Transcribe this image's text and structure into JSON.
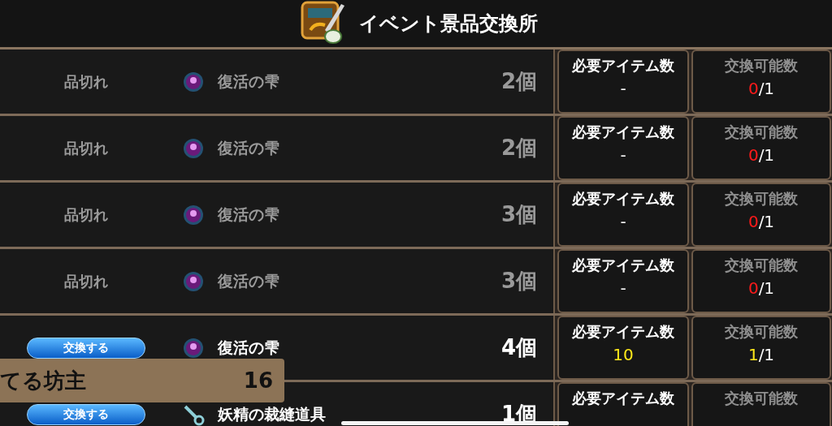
{
  "header": {
    "title": "イベント景品交換所"
  },
  "rows": [
    {
      "kind": "sold_out",
      "status": "品切れ",
      "item": {
        "kind": "orb",
        "name": "復活の雫"
      },
      "count": "2個",
      "required_label": "必要アイテム数",
      "required_value": "-",
      "exchange_label": "交換可能数",
      "exchange_done": "0",
      "exchange_total": "/1"
    },
    {
      "kind": "sold_out",
      "status": "品切れ",
      "item": {
        "kind": "orb",
        "name": "復活の雫"
      },
      "count": "2個",
      "required_label": "必要アイテム数",
      "required_value": "-",
      "exchange_label": "交換可能数",
      "exchange_done": "0",
      "exchange_total": "/1"
    },
    {
      "kind": "sold_out",
      "status": "品切れ",
      "item": {
        "kind": "orb",
        "name": "復活の雫"
      },
      "count": "3個",
      "required_label": "必要アイテム数",
      "required_value": "-",
      "exchange_label": "交換可能数",
      "exchange_done": "0",
      "exchange_total": "/1"
    },
    {
      "kind": "sold_out",
      "status": "品切れ",
      "item": {
        "kind": "orb",
        "name": "復活の雫"
      },
      "count": "3個",
      "required_label": "必要アイテム数",
      "required_value": "-",
      "exchange_label": "交換可能数",
      "exchange_done": "0",
      "exchange_total": "/1"
    },
    {
      "kind": "available",
      "status": "交換する",
      "item": {
        "kind": "orb",
        "name": "復活の雫"
      },
      "count": "4個",
      "required_label": "必要アイテム数",
      "required_value": "10",
      "exchange_label": "交換可能数",
      "exchange_done": "1",
      "exchange_total": "/1"
    },
    {
      "kind": "available",
      "status": "交換する",
      "item": {
        "kind": "tool",
        "name": "妖精の裁縫道具"
      },
      "count": "1個",
      "required_label": "必要アイテム数",
      "exchange_label": "交換可能数"
    }
  ],
  "toast": {
    "name": "てる坊主",
    "value": "16"
  }
}
